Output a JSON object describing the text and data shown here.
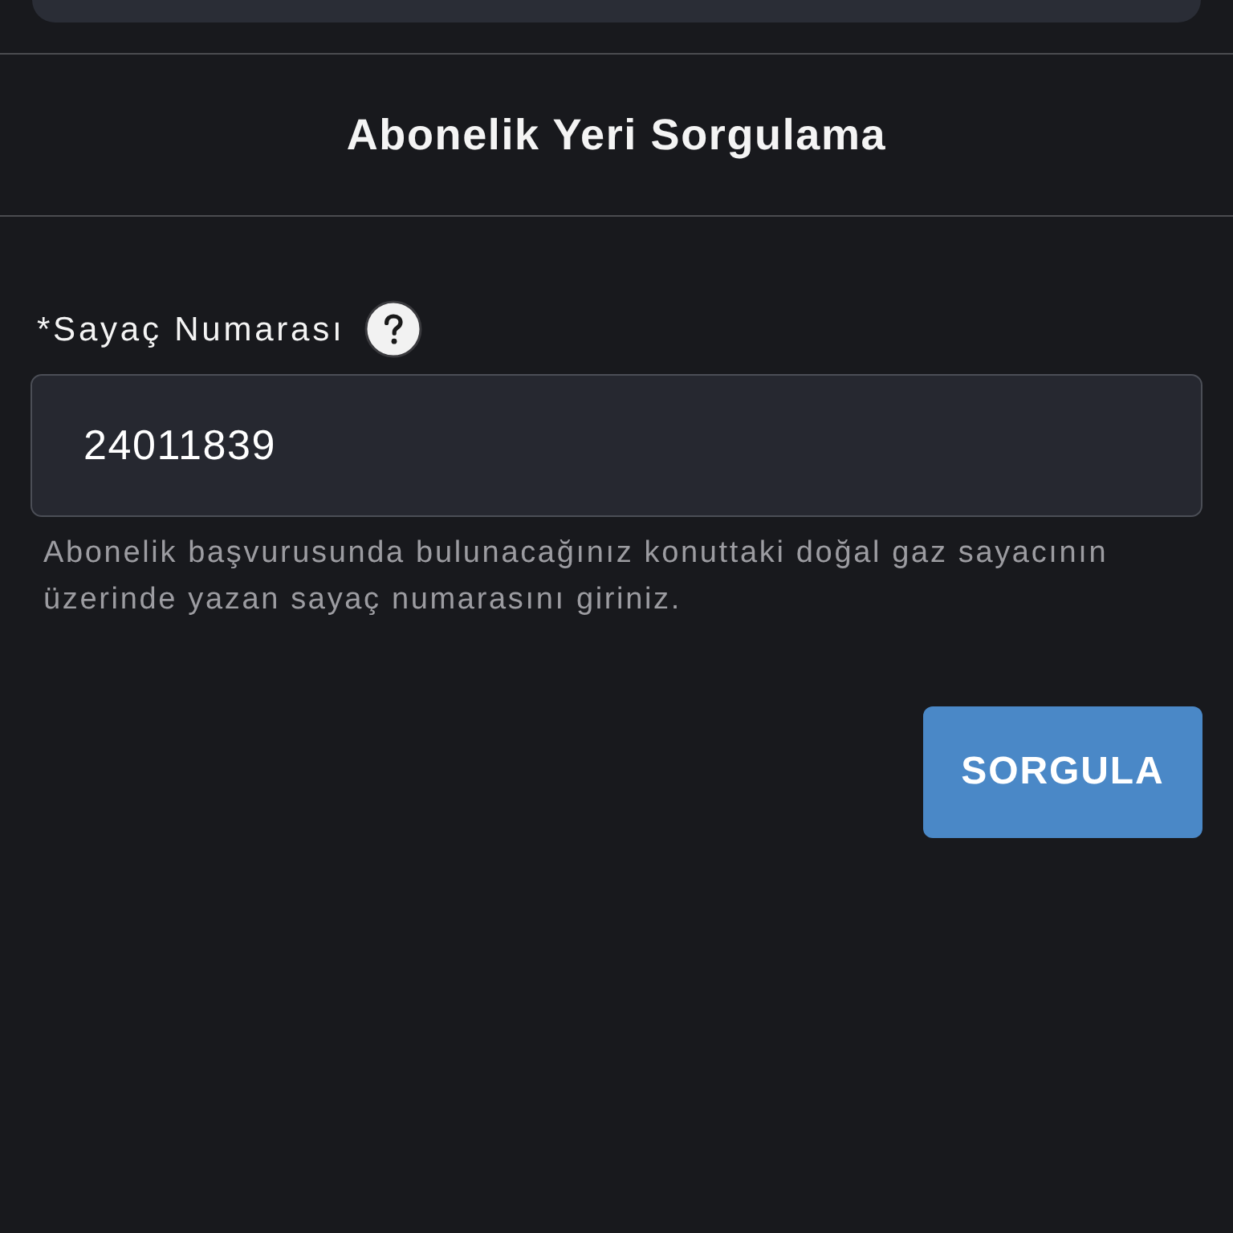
{
  "page_title": "Abonelik Yeri Sorgulama",
  "field": {
    "label": "*Sayaç Numarası",
    "value": "24011839",
    "help": "Abonelik başvurusunda bulunacağınız konuttaki doğal gaz sayacının üzerinde yazan sayaç numarasını giriniz."
  },
  "submit_button": {
    "label": "SORGULA"
  }
}
